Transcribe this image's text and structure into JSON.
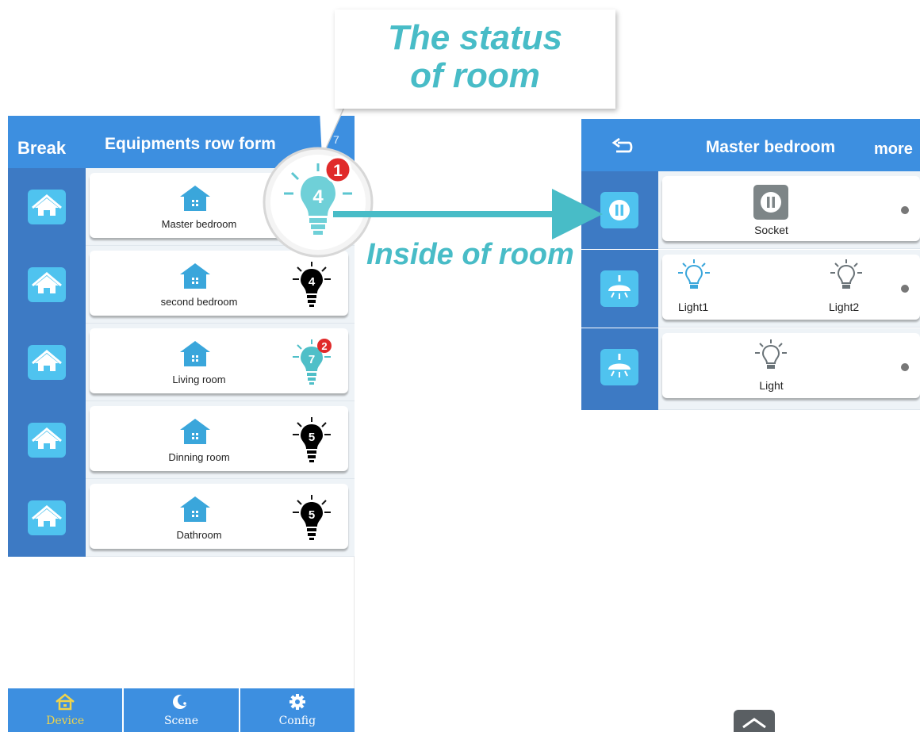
{
  "left_app": {
    "header": {
      "back_label": "Break",
      "title": "Equipments row form",
      "right_fragment": "7"
    },
    "rooms": [
      {
        "name": "Master bedroom",
        "bulb_count": "4",
        "alert_count": "1",
        "status": "on"
      },
      {
        "name": "second bedroom",
        "bulb_count": "4",
        "alert_count": "",
        "status": "off"
      },
      {
        "name": "Living room",
        "bulb_count": "7",
        "alert_count": "2",
        "status": "on"
      },
      {
        "name": "Dinning room",
        "bulb_count": "5",
        "alert_count": "",
        "status": "off"
      },
      {
        "name": "Dathroom",
        "bulb_count": "5",
        "alert_count": "",
        "status": "off"
      }
    ],
    "tabs": [
      {
        "label": "Device",
        "icon": "home-icon",
        "active": true
      },
      {
        "label": "Scene",
        "icon": "moon-icon",
        "active": false
      },
      {
        "label": "Config",
        "icon": "gear-icon",
        "active": false
      }
    ]
  },
  "right_app": {
    "header": {
      "title": "Master bedroom",
      "more_label": "more",
      "back_icon": "back-arrow-icon"
    },
    "devices": [
      {
        "type": "socket",
        "labels": [
          "Socket"
        ]
      },
      {
        "type": "lamp",
        "labels": [
          "Light1",
          "Light2"
        ]
      },
      {
        "type": "lamp",
        "labels": [
          "Light"
        ]
      }
    ]
  },
  "annotations": {
    "callout_line1": "The status",
    "callout_line2": "of room",
    "arrow_label": "Inside of room",
    "magnifier_count": "4",
    "magnifier_alert": "1"
  },
  "colors": {
    "header_blue": "#3d8fe0",
    "side_blue": "#3d7ac4",
    "icon_cyan": "#4fc3ef",
    "accent_teal": "#48bcc7",
    "badge_red": "#e02a2a",
    "active_tab": "#f0d44a"
  }
}
